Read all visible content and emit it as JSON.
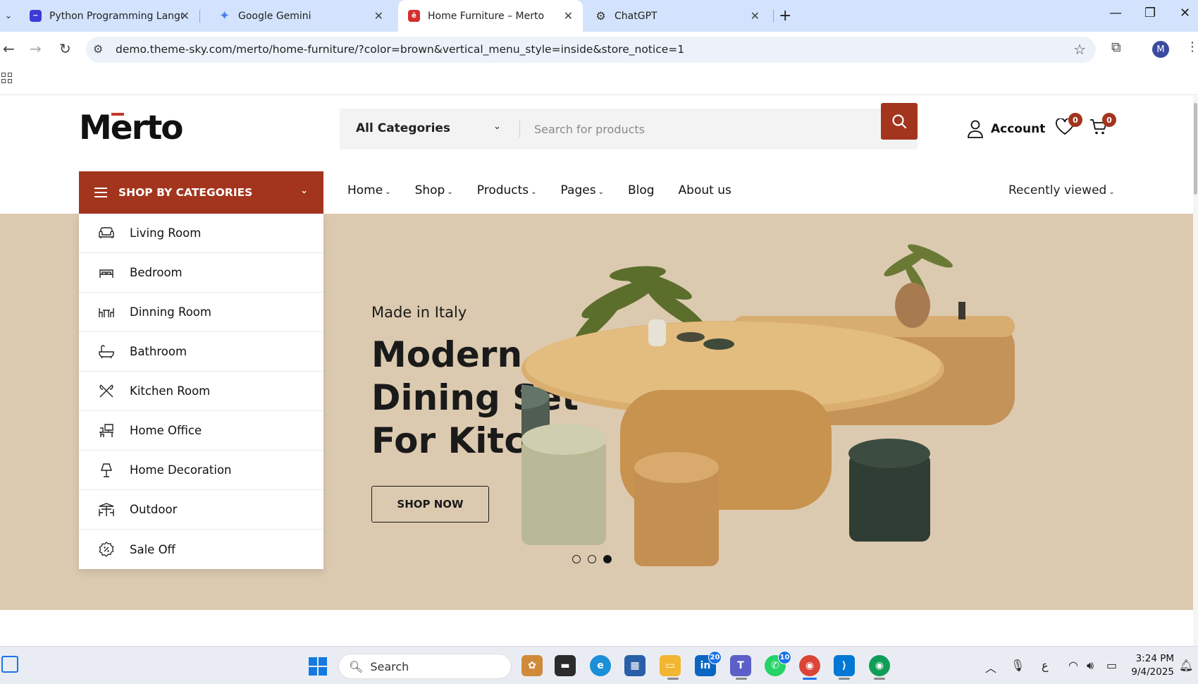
{
  "browser": {
    "tabs": [
      {
        "title": "Python Programming Language",
        "favicon": "python-favicon",
        "active": false
      },
      {
        "title": "Google Gemini",
        "favicon": "gemini-favicon",
        "active": false
      },
      {
        "title": "Home Furniture – Merto",
        "favicon": "merto-favicon",
        "active": true
      },
      {
        "title": "ChatGPT",
        "favicon": "chatgpt-favicon",
        "active": false
      }
    ],
    "url": "demo.theme-sky.com/merto/home-furniture/?color=brown&vertical_menu_style=inside&store_notice=1",
    "profile_initial": "M"
  },
  "site": {
    "logo": "Merto",
    "accent_color": "#a3351e",
    "search": {
      "category_label": "All Categories",
      "placeholder": "Search for products"
    },
    "account_label": "Account",
    "wishlist_count": "0",
    "cart_count": "0",
    "categories_header": "SHOP BY CATEGORIES",
    "categories": [
      {
        "label": "Living Room",
        "icon": "sofa-icon"
      },
      {
        "label": "Bedroom",
        "icon": "bed-icon"
      },
      {
        "label": "Dinning Room",
        "icon": "dining-table-icon"
      },
      {
        "label": "Bathroom",
        "icon": "bathtub-icon"
      },
      {
        "label": "Kitchen Room",
        "icon": "utensils-icon"
      },
      {
        "label": "Home Office",
        "icon": "office-desk-icon"
      },
      {
        "label": "Home Decoration",
        "icon": "lamp-icon"
      },
      {
        "label": "Outdoor",
        "icon": "outdoor-table-icon"
      },
      {
        "label": "Sale Off",
        "icon": "discount-icon"
      }
    ],
    "nav": [
      {
        "label": "Home",
        "dropdown": true
      },
      {
        "label": "Shop",
        "dropdown": true
      },
      {
        "label": "Products",
        "dropdown": true
      },
      {
        "label": "Pages",
        "dropdown": true
      },
      {
        "label": "Blog",
        "dropdown": false
      },
      {
        "label": "About us",
        "dropdown": false
      }
    ],
    "recently_viewed": "Recently viewed",
    "hero": {
      "subtitle": "Made in Italy",
      "title_lines": [
        "Modern",
        "Dining Set",
        "For Kitchen"
      ],
      "cta": "SHOP NOW",
      "slide_count": 3,
      "active_slide": 3,
      "background": "#dccab0"
    }
  },
  "taskbar": {
    "search_label": "Search",
    "linkedin_badge": "20",
    "whatsapp_badge": "10",
    "time": "3:24 PM",
    "date": "9/4/2025",
    "language": "ع"
  }
}
